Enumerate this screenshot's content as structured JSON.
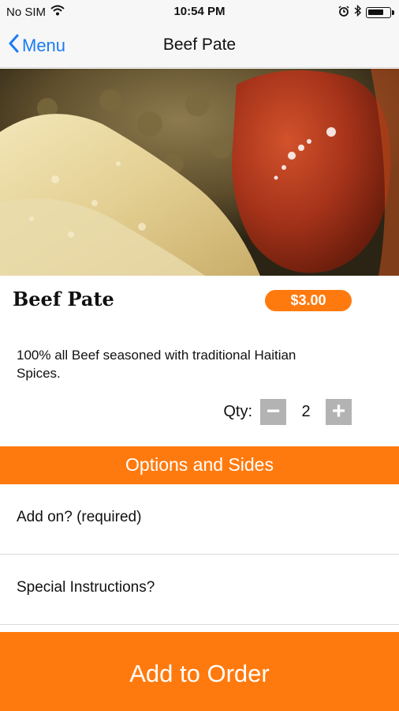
{
  "status_bar": {
    "carrier": "No SIM",
    "time": "10:54 PM",
    "battery_level": 0.75,
    "icons": [
      "wifi-icon",
      "alarm-icon",
      "bluetooth-icon",
      "battery-icon"
    ]
  },
  "nav": {
    "back_label": "Menu",
    "title": "Beef Pate"
  },
  "item": {
    "name": "Beef Pate",
    "price": "$3.00",
    "description": "100% all Beef seasoned with traditional Haitian Spices."
  },
  "quantity": {
    "label": "Qty:",
    "minus": "−",
    "value": "2",
    "plus": "+"
  },
  "options": {
    "header": "Options and Sides",
    "rows": [
      {
        "label": "Add on?  (required)"
      },
      {
        "label": "Special Instructions?"
      }
    ]
  },
  "footer": {
    "add_label": "Add to Order"
  },
  "colors": {
    "accent": "#ff7a0e",
    "link": "#1a7cf5",
    "stepper": "#b3b3b3"
  }
}
